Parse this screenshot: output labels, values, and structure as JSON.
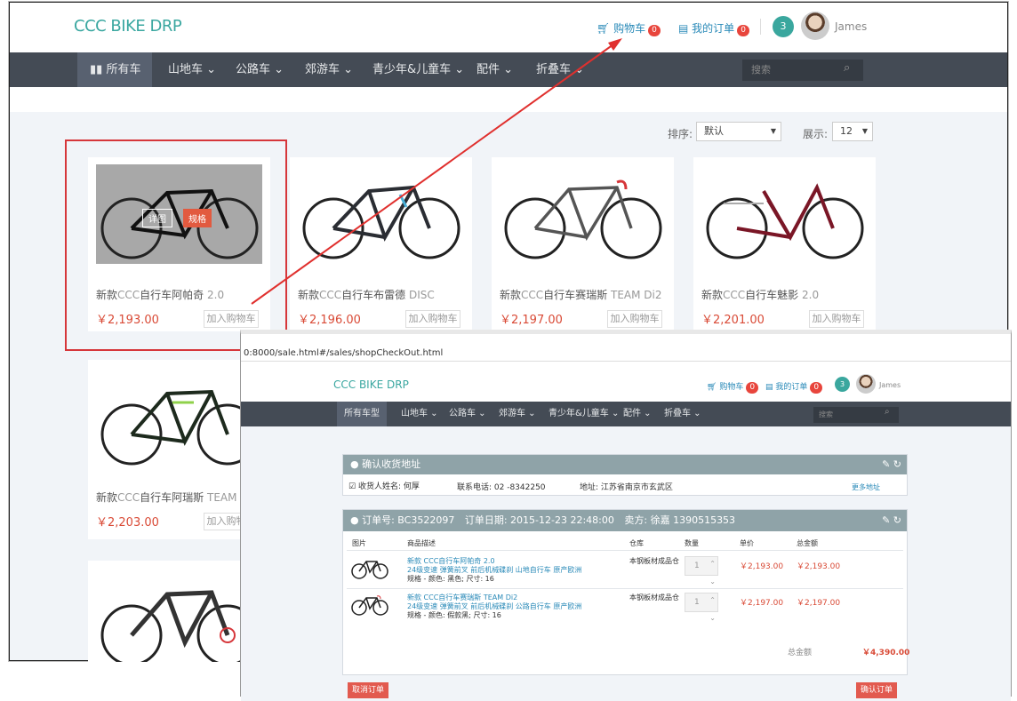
{
  "shop": {
    "logo": "CCC BIKE DRP",
    "cart_label": "购物车",
    "cart_count": "0",
    "orders_label": "我的订单",
    "orders_count": "0",
    "msg_count": "3",
    "user_name": "James",
    "nav": [
      "所有车型",
      "山地车 ⌄",
      "公路车 ⌄",
      "郊游车 ⌄",
      "青少年&儿童车 ⌄",
      "配件 ⌄",
      "折叠车 ⌄"
    ],
    "search_placeholder": "搜索",
    "sort_label": "排序:",
    "sort_value": "默认",
    "show_label": "展示:",
    "show_value": "12",
    "quickview_label": "详图",
    "spec_label": "规格",
    "add_cart_label": "加入购物车",
    "products": [
      {
        "name_prefix": "新款",
        "brand": "CCC",
        "name_rest": "自行车阿帕奇",
        "suffix": "2.0",
        "price": "￥2,193.00"
      },
      {
        "name_prefix": "新款",
        "brand": "CCC",
        "name_rest": "自行车布雷德",
        "suffix": "DISC",
        "price": "￥2,196.00"
      },
      {
        "name_prefix": "新款",
        "brand": "CCC",
        "name_rest": "自行车赛瑞斯",
        "suffix": "TEAM Di2",
        "price": "￥2,197.00"
      },
      {
        "name_prefix": "新款",
        "brand": "CCC",
        "name_rest": "自行车魅影",
        "suffix": "2.0",
        "price": "￥2,201.00"
      },
      {
        "name_prefix": "新款",
        "brand": "CCC",
        "name_rest": "自行车阿瑞斯",
        "suffix": "TEAM",
        "price": "￥2,203.00"
      }
    ]
  },
  "checkout": {
    "url": "0:8000/sale.html#/sales/shopCheckOut.html",
    "address_title": "确认收货地址",
    "receiver": "收货人姓名: 何厚",
    "phone": "联系电话: 02 -8342250",
    "address": "地址: 江苏省南京市玄武区",
    "more_address": "更多地址",
    "order_no": "订单号:  BC3522097",
    "order_date": "订单日期:  2015-12-23 22:48:00",
    "seller": "卖方:  徐嘉    1390515353",
    "headers": [
      "图片",
      "商品描述",
      "仓库",
      "数量",
      "单价",
      "总金额"
    ],
    "items": [
      {
        "title": "新款  CCC自行车阿帕奇 2.0",
        "desc": "24级变速 弹簧前叉 前后机械碟刹 山地自行车 原产欧洲",
        "spec": "规格 - 颜色: 黑色; 尺寸: 16",
        "warehouse": "本钢板材成品仓",
        "qty": "1",
        "unit": "￥2,193.00",
        "total": "￥2,193.00"
      },
      {
        "title": "新款  CCC自行车赛瑞斯 TEAM Di2",
        "desc": "24级变速 弹簧前叉 前后机械碟刹 公路自行车 原产欧洲",
        "spec": "规格 - 颜色: 假款黑; 尺寸: 16",
        "warehouse": "本钢板材成品仓",
        "qty": "1",
        "unit": "￥2,197.00",
        "total": "￥2,197.00"
      }
    ],
    "grand_total_label": "总金额",
    "grand_total": "￥4,390.00",
    "cancel_label": "取消订单",
    "confirm_label": "确认订单"
  },
  "colors": {
    "accent": "#3aa7a0",
    "price": "#d94a36",
    "nav": "#444b55",
    "annotation": "#d6363a"
  }
}
